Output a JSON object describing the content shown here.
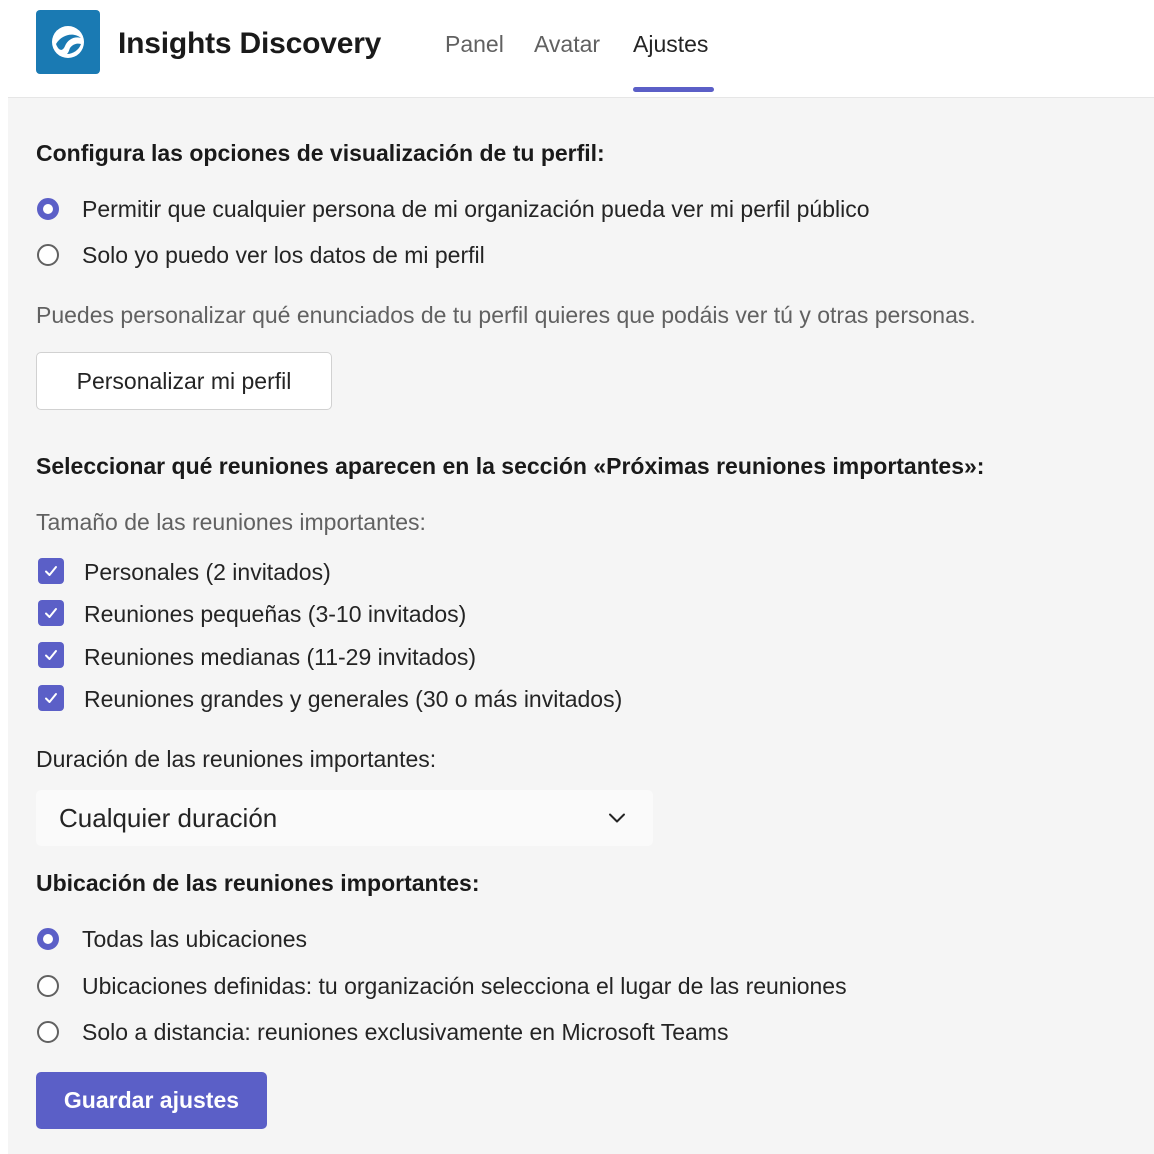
{
  "header": {
    "logo_icon": "insights-discovery-logo",
    "app_title": "Insights Discovery",
    "tabs": [
      {
        "label": "Panel",
        "active": false
      },
      {
        "label": "Avatar",
        "active": false
      },
      {
        "label": "Ajustes",
        "active": true
      }
    ],
    "accent_color": "#5b5fc7"
  },
  "profile_visibility": {
    "heading": "Configura las opciones de visualización de tu perfil:",
    "options": [
      {
        "label": "Permitir que cualquier persona de mi organización pueda ver mi perfil público",
        "selected": true
      },
      {
        "label": "Solo yo puedo ver los datos de mi perfil",
        "selected": false
      }
    ],
    "hint": "Puedes personalizar qué enunciados de tu perfil quieres que podáis ver tú y otras personas.",
    "customize_button": "Personalizar mi perfil"
  },
  "meetings": {
    "heading": "Seleccionar qué reuniones aparecen en la sección «Próximas reuniones importantes»:",
    "size_label": "Tamaño de las reuniones importantes:",
    "sizes": [
      {
        "label": "Personales (2 invitados)",
        "checked": true
      },
      {
        "label": "Reuniones pequeñas (3-10 invitados)",
        "checked": true
      },
      {
        "label": "Reuniones medianas (11-29 invitados)",
        "checked": true
      },
      {
        "label": "Reuniones grandes y generales (30 o más invitados)",
        "checked": true
      }
    ],
    "duration_label": "Duración de las reuniones importantes:",
    "duration_value": "Cualquier duración",
    "location_heading": "Ubicación de las reuniones importantes:",
    "locations": [
      {
        "label": "Todas las ubicaciones",
        "selected": true
      },
      {
        "label": "Ubicaciones definidas: tu organización selecciona el lugar de las reuniones",
        "selected": false
      },
      {
        "label": "Solo a distancia: reuniones exclusivamente en Microsoft Teams",
        "selected": false
      }
    ]
  },
  "save_button": "Guardar ajustes"
}
